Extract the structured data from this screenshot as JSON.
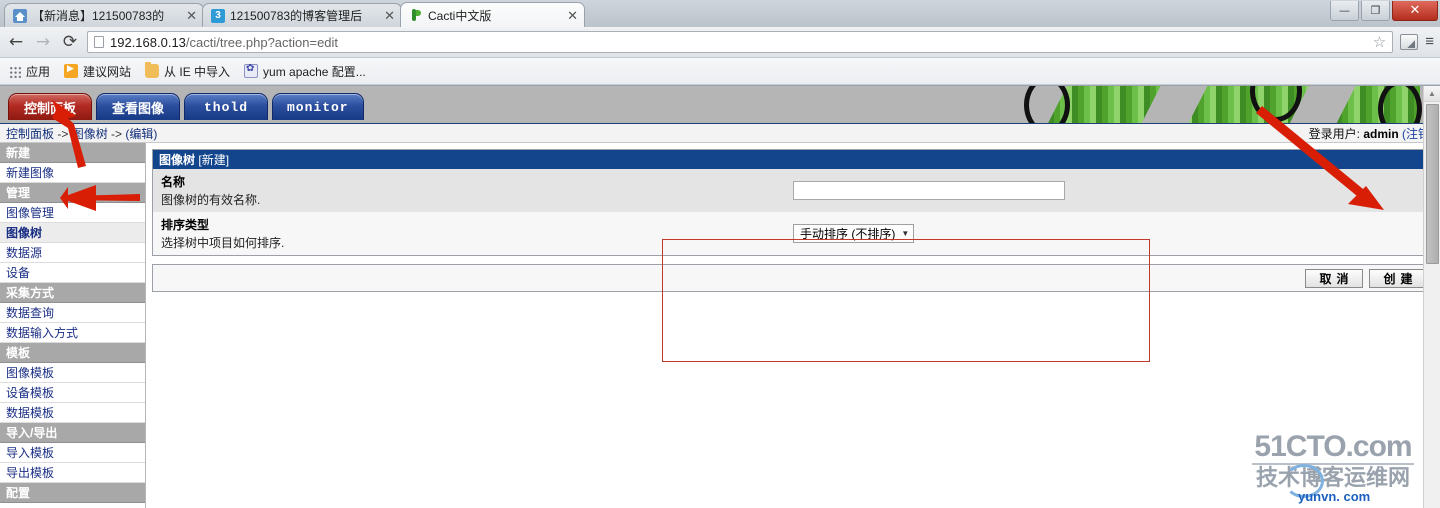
{
  "browser": {
    "tabs": [
      {
        "title": "【新消息】121500783的",
        "icon": "home-icon",
        "active": false
      },
      {
        "title": "121500783的博客管理后",
        "icon": "blog-icon",
        "active": false
      },
      {
        "title": "Cacti中文版",
        "icon": "cacti-icon",
        "active": true
      }
    ],
    "tab_close_glyph": "✕",
    "window_controls": {
      "minimize": "—",
      "restore": "❐",
      "close": "✕"
    },
    "nav": {
      "back": "←",
      "forward": "→",
      "reload": "⟳"
    },
    "omnibox": {
      "host": "192.168.0.13",
      "path": "/cacti/tree.php?action=edit",
      "star": "☆",
      "menu": "≡"
    },
    "bookmarks": [
      {
        "label": "应用",
        "icon": "apps-grid-icon"
      },
      {
        "label": "建议网站",
        "icon": "bing-icon"
      },
      {
        "label": "从 IE 中导入",
        "icon": "folder-icon"
      },
      {
        "label": "yum apache 配置...",
        "icon": "baidu-icon"
      }
    ]
  },
  "cacti": {
    "tabs": [
      {
        "label": "控制面板",
        "active": true,
        "mono": false
      },
      {
        "label": "查看图像",
        "active": false,
        "mono": false
      },
      {
        "label": "thold",
        "active": false,
        "mono": true
      },
      {
        "label": "monitor",
        "active": false,
        "mono": true
      }
    ],
    "breadcrumb": {
      "root": "控制面板",
      "sep1": " -> ",
      "node": "图像树",
      "sep2": " -> ",
      "current": "(编辑)"
    },
    "login": {
      "prefix": "登录用户: ",
      "user": "admin",
      "logout": "(注销)"
    },
    "sidebar": [
      {
        "type": "header",
        "label": "新建"
      },
      {
        "type": "item",
        "label": "新建图像",
        "selected": false
      },
      {
        "type": "header",
        "label": "管理"
      },
      {
        "type": "item",
        "label": "图像管理",
        "selected": false
      },
      {
        "type": "item",
        "label": "图像树",
        "selected": true
      },
      {
        "type": "item",
        "label": "数据源",
        "selected": false
      },
      {
        "type": "item",
        "label": "设备",
        "selected": false
      },
      {
        "type": "header",
        "label": "采集方式"
      },
      {
        "type": "item",
        "label": "数据查询",
        "selected": false
      },
      {
        "type": "item",
        "label": "数据输入方式",
        "selected": false
      },
      {
        "type": "header",
        "label": "模板"
      },
      {
        "type": "item",
        "label": "图像模板",
        "selected": false
      },
      {
        "type": "item",
        "label": "设备模板",
        "selected": false
      },
      {
        "type": "item",
        "label": "数据模板",
        "selected": false
      },
      {
        "type": "header",
        "label": "导入/导出"
      },
      {
        "type": "item",
        "label": "导入模板",
        "selected": false
      },
      {
        "type": "item",
        "label": "导出模板",
        "selected": false
      },
      {
        "type": "header",
        "label": "配置"
      }
    ],
    "form": {
      "panel_title": "图像树",
      "panel_subtitle": "[新建]",
      "fields": [
        {
          "label": "名称",
          "description": "图像树的有效名称.",
          "control": "text",
          "value": "",
          "placeholder": ""
        },
        {
          "label": "排序类型",
          "description": "选择树中项目如何排序.",
          "control": "select",
          "value": "手动排序 (不排序)",
          "arrow": "▼"
        }
      ],
      "buttons": [
        {
          "label": "取消",
          "name": "cancel"
        },
        {
          "label": "创建",
          "name": "create"
        }
      ]
    }
  },
  "watermark": {
    "line1": "51CTO.com",
    "line2": "技术博客运维网",
    "line3": "yunvn. com"
  },
  "scrollbar": {
    "up_arrow": "▲"
  },
  "colors": {
    "cacti_blue": "#12458c",
    "cacti_tab_active_red": "#b22a22",
    "annotation_red": "#d81f06",
    "link_blue": "#1b2f84"
  }
}
